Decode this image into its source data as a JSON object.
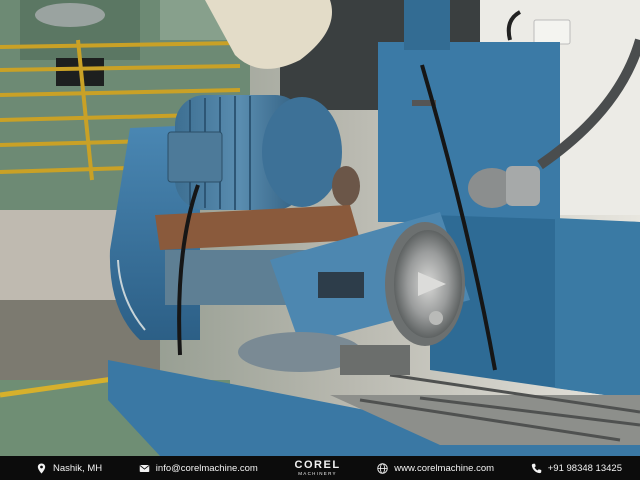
{
  "photo": {
    "subject": "Blue rotary surface grinding machine with magnetic chuck and electric motor in a workshop",
    "colors": {
      "machine_blue": "#3c7aa6",
      "machine_blue_dark": "#295a7e",
      "rust": "#8a5a3c"
    }
  },
  "footer": {
    "location": "Nashik, MH",
    "email": "info@corelmachine.com",
    "brand_name": "COREL",
    "brand_tagline": "MACHINERY",
    "website": "www.corelmachine.com",
    "phone": "+91 98348 13425",
    "icons": [
      "location-pin-icon",
      "email-icon",
      "globe-icon",
      "phone-icon"
    ],
    "colors": {
      "background": "#0c0c0c",
      "text": "#f2f2f2"
    }
  }
}
